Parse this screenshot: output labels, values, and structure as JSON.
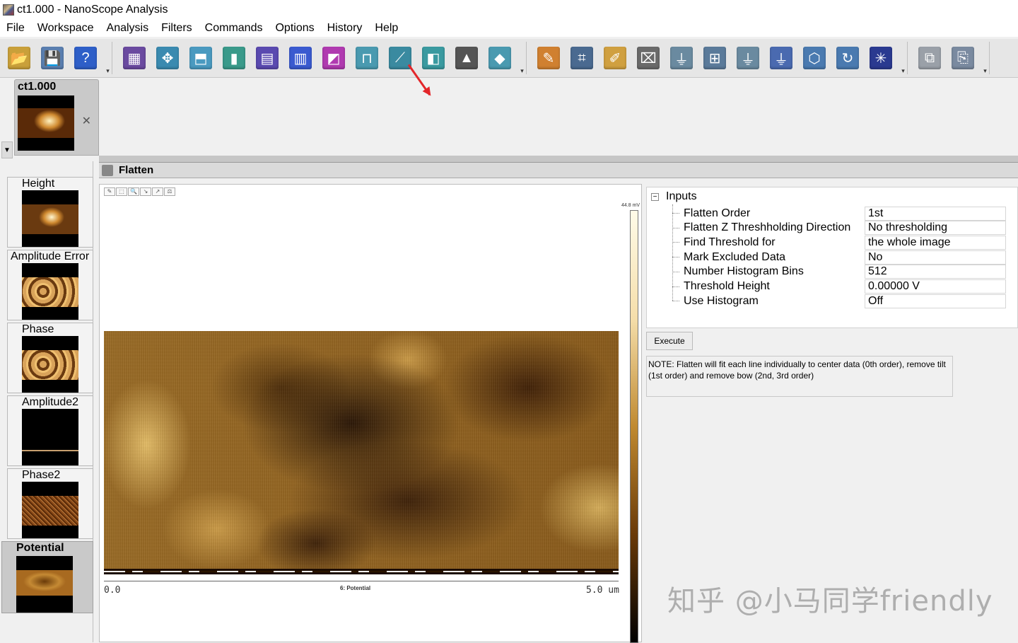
{
  "window": {
    "title": "ct1.000 - NanoScope Analysis"
  },
  "menu": [
    "File",
    "Workspace",
    "Analysis",
    "Filters",
    "Commands",
    "Options",
    "History",
    "Help"
  ],
  "toolbar": {
    "group1": [
      {
        "icon": "open-folder-icon",
        "color": "#c9a03a",
        "glyph": "📂"
      },
      {
        "icon": "save-icon",
        "color": "#5a7fb0",
        "glyph": "💾"
      },
      {
        "icon": "help-icon",
        "color": "#2e5fc8",
        "glyph": "?"
      }
    ],
    "group2": [
      {
        "icon": "image-grid-icon",
        "color": "#6a4aa0",
        "glyph": "▦"
      },
      {
        "icon": "3d-view-icon",
        "color": "#3a8ab0",
        "glyph": "✥"
      },
      {
        "icon": "surface-plot-icon",
        "color": "#4a9ac0",
        "glyph": "⬒"
      },
      {
        "icon": "section-icon",
        "color": "#3a9a8a",
        "glyph": "▮"
      },
      {
        "icon": "roughness-icon",
        "color": "#5a4ab0",
        "glyph": "▤"
      },
      {
        "icon": "histogram-icon",
        "color": "#3a5ad0",
        "glyph": "▥"
      },
      {
        "icon": "spectrum-icon",
        "color": "#b03ab0",
        "glyph": "◩"
      },
      {
        "icon": "step-height-icon",
        "color": "#4a9ab0",
        "glyph": "⊓"
      },
      {
        "icon": "flatten-icon",
        "color": "#3a8aa0",
        "glyph": "⟋"
      },
      {
        "icon": "depth-icon",
        "color": "#3a9aa0",
        "glyph": "◧"
      },
      {
        "icon": "bearing-icon",
        "color": "#555555",
        "glyph": "▲"
      },
      {
        "icon": "particle-icon",
        "color": "#4a9ab0",
        "glyph": "◆"
      }
    ],
    "group3": [
      {
        "icon": "eraser-icon",
        "color": "#d08030",
        "glyph": "✎"
      },
      {
        "icon": "crop-icon",
        "color": "#4a6a90",
        "glyph": "⌗"
      },
      {
        "icon": "brush-icon",
        "color": "#d0a040",
        "glyph": "✐"
      },
      {
        "icon": "roller-icon",
        "color": "#6a6a6a",
        "glyph": "⌧"
      },
      {
        "icon": "filter-funnel-icon",
        "color": "#6a8aa0",
        "glyph": "⏚"
      },
      {
        "icon": "matrix-icon",
        "color": "#5a7a9a",
        "glyph": "⊞"
      },
      {
        "icon": "filter-plane-icon",
        "color": "#6a8aa0",
        "glyph": "⏚"
      },
      {
        "icon": "filter-grid-icon",
        "color": "#4a6ab0",
        "glyph": "⏚"
      },
      {
        "icon": "tilt-icon",
        "color": "#4a7ab0",
        "glyph": "⬡"
      },
      {
        "icon": "rotate-icon",
        "color": "#4a7ab0",
        "glyph": "↻"
      },
      {
        "icon": "fft-icon",
        "color": "#2a3a90",
        "glyph": "✳"
      }
    ],
    "group4": [
      {
        "icon": "layout-icon",
        "color": "#9aa0a8",
        "glyph": "⧉"
      },
      {
        "icon": "book-icon",
        "color": "#7a8aa0",
        "glyph": "⎘"
      }
    ],
    "more_glyph": "▾"
  },
  "file_tab": {
    "name": "ct1.000",
    "close_glyph": "✕"
  },
  "channels": [
    {
      "label": "Height",
      "style": "height"
    },
    {
      "label": "Amplitude Error",
      "style": "amp"
    },
    {
      "label": "Phase",
      "style": "amp"
    },
    {
      "label": "Amplitude2",
      "style": "dark"
    },
    {
      "label": "Phase2",
      "style": "phase2"
    },
    {
      "label": "Potential",
      "style": "potential",
      "active": true
    }
  ],
  "flatten": {
    "title": "Flatten",
    "image": {
      "mini_tools": [
        "✎",
        "⬚",
        "🔍",
        "↘",
        "↗",
        "⚖"
      ],
      "colorbar_max": "44.8 mV",
      "x_start": "0.0",
      "x_end": "5.0 um",
      "channel_title": "6: Potential"
    },
    "inputs_title": "Inputs",
    "collapse_glyph": "−",
    "properties": [
      {
        "name": "Flatten Order",
        "value": "1st"
      },
      {
        "name": "Flatten Z Threshholding Direction",
        "value": "No thresholding"
      },
      {
        "name": "Find Threshold for",
        "value": "the whole image"
      },
      {
        "name": "Mark Excluded Data",
        "value": "No"
      },
      {
        "name": "Number Histogram Bins",
        "value": "512"
      },
      {
        "name": "Threshold Height",
        "value": "0.00000 V"
      },
      {
        "name": "Use Histogram",
        "value": "Off"
      }
    ],
    "execute_label": "Execute",
    "note": "NOTE:  Flatten will fit each line individually to center data (0th order), remove tilt (1st order) and remove bow (2nd, 3rd order)"
  },
  "watermark": "知乎 @小马同学friendly",
  "colors": {
    "annotation_red": "#e3262a",
    "active_tab": "#c9c9c9"
  }
}
